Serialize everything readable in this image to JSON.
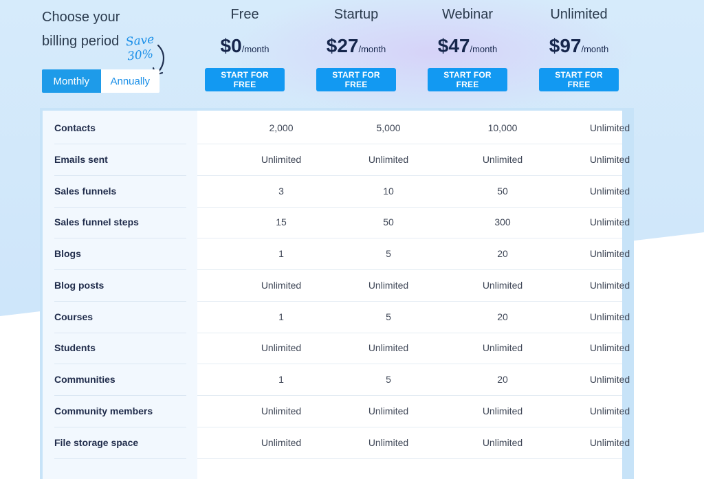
{
  "billing": {
    "title": "Choose your billing period",
    "save_note": "Save 30%",
    "options": [
      {
        "label": "Monthly",
        "active": true
      },
      {
        "label": "Annually",
        "active": false
      }
    ]
  },
  "plans": [
    {
      "name": "Free",
      "price": "$0",
      "period": "/month",
      "cta": "START FOR FREE"
    },
    {
      "name": "Startup",
      "price": "$27",
      "period": "/month",
      "cta": "START FOR FREE"
    },
    {
      "name": "Webinar",
      "price": "$47",
      "period": "/month",
      "cta": "START FOR FREE"
    },
    {
      "name": "Unlimited",
      "price": "$97",
      "period": "/month",
      "cta": "START FOR FREE"
    }
  ],
  "features": [
    {
      "label": "Contacts",
      "values": [
        "2,000",
        "5,000",
        "10,000",
        "Unlimited"
      ]
    },
    {
      "label": "Emails sent",
      "values": [
        "Unlimited",
        "Unlimited",
        "Unlimited",
        "Unlimited"
      ]
    },
    {
      "label": "Sales funnels",
      "values": [
        "3",
        "10",
        "50",
        "Unlimited"
      ]
    },
    {
      "label": "Sales funnel steps",
      "values": [
        "15",
        "50",
        "300",
        "Unlimited"
      ]
    },
    {
      "label": "Blogs",
      "values": [
        "1",
        "5",
        "20",
        "Unlimited"
      ]
    },
    {
      "label": "Blog posts",
      "values": [
        "Unlimited",
        "Unlimited",
        "Unlimited",
        "Unlimited"
      ]
    },
    {
      "label": "Courses",
      "values": [
        "1",
        "5",
        "20",
        "Unlimited"
      ]
    },
    {
      "label": "Students",
      "values": [
        "Unlimited",
        "Unlimited",
        "Unlimited",
        "Unlimited"
      ]
    },
    {
      "label": "Communities",
      "values": [
        "1",
        "5",
        "20",
        "Unlimited"
      ]
    },
    {
      "label": "Community members",
      "values": [
        "Unlimited",
        "Unlimited",
        "Unlimited",
        "Unlimited"
      ]
    },
    {
      "label": "File storage space",
      "values": [
        "Unlimited",
        "Unlimited",
        "Unlimited",
        "Unlimited"
      ]
    }
  ],
  "colors": {
    "accent": "#1299f2",
    "toggle_active": "#1e9be9",
    "heading": "#16264c",
    "background": "#cfe6fa"
  }
}
